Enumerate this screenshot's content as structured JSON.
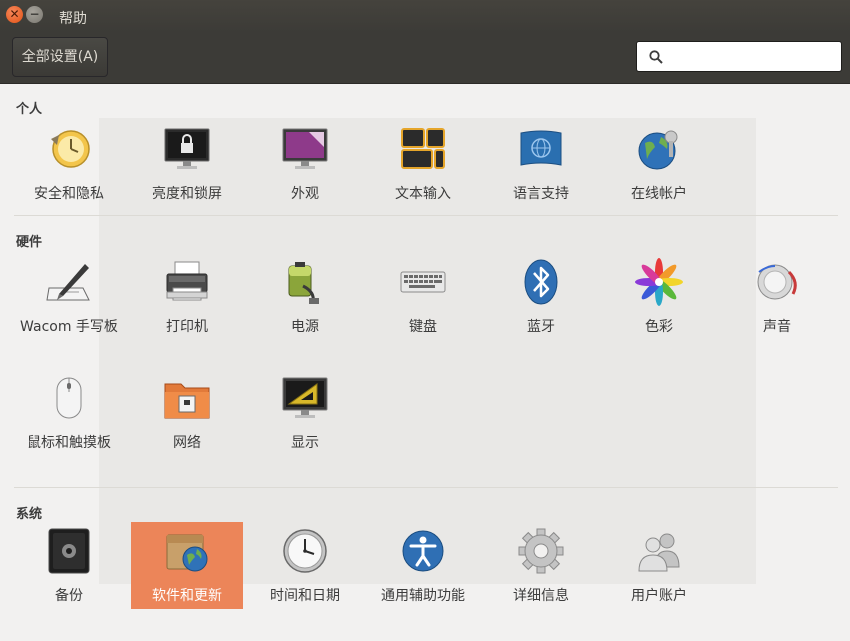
{
  "window": {
    "title": "帮助",
    "close_symbol": "✕",
    "minimize_symbol": "−"
  },
  "toolbar": {
    "all_settings_label": "全部设置(A)",
    "search": {
      "value": "",
      "placeholder": ""
    }
  },
  "sections": {
    "personal": {
      "title": "个人",
      "items": [
        {
          "label": "安全和隐私",
          "icon": "security-privacy-icon"
        },
        {
          "label": "亮度和锁屏",
          "icon": "brightness-lock-icon"
        },
        {
          "label": "外观",
          "icon": "appearance-icon"
        },
        {
          "label": "文本输入",
          "icon": "text-entry-icon"
        },
        {
          "label": "语言支持",
          "icon": "language-support-icon"
        },
        {
          "label": "在线帐户",
          "icon": "online-accounts-icon"
        }
      ]
    },
    "hardware": {
      "title": "硬件",
      "items": [
        {
          "label": "Wacom 手写板",
          "icon": "wacom-tablet-icon"
        },
        {
          "label": "打印机",
          "icon": "printer-icon"
        },
        {
          "label": "电源",
          "icon": "power-icon"
        },
        {
          "label": "键盘",
          "icon": "keyboard-icon"
        },
        {
          "label": "蓝牙",
          "icon": "bluetooth-icon"
        },
        {
          "label": "色彩",
          "icon": "color-icon"
        },
        {
          "label": "声音",
          "icon": "sound-icon"
        },
        {
          "label": "鼠标和触摸板",
          "icon": "mouse-touchpad-icon"
        },
        {
          "label": "网络",
          "icon": "network-icon"
        },
        {
          "label": "显示",
          "icon": "displays-icon"
        }
      ]
    },
    "system": {
      "title": "系统",
      "items": [
        {
          "label": "备份",
          "icon": "backup-icon"
        },
        {
          "label": "软件和更新",
          "icon": "software-updates-icon",
          "selected": true
        },
        {
          "label": "时间和日期",
          "icon": "time-date-icon"
        },
        {
          "label": "通用辅助功能",
          "icon": "universal-access-icon"
        },
        {
          "label": "详细信息",
          "icon": "details-icon"
        },
        {
          "label": "用户账户",
          "icon": "user-accounts-icon"
        }
      ]
    }
  },
  "colors": {
    "titlebar": "#3c3b37",
    "background": "#f2f1f0",
    "selection": "#ec8559"
  }
}
